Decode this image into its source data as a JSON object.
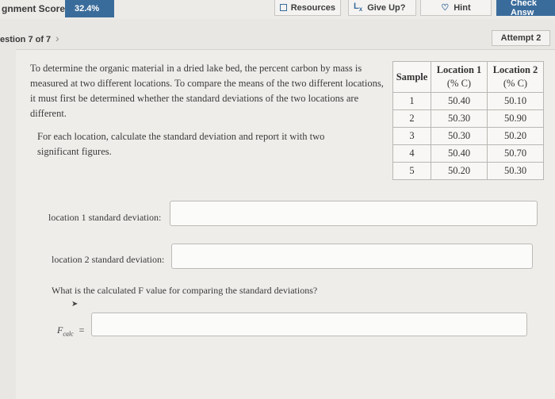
{
  "topbar": {
    "score_label": "gnment Score:",
    "score_value": "32.4%",
    "resources_label": "Resources",
    "giveup_label": "Give Up?",
    "hint_label": "Hint",
    "check_label": "Check Answ"
  },
  "nav": {
    "question_label": "estion 7 of 7",
    "next_glyph": "›",
    "attempt_label": "Attempt 2"
  },
  "question": {
    "paragraph1": "To determine the organic material in a dried lake bed, the percent carbon by mass is measured at two different locations. To compare the means of the two different locations, it must first be determined whether the standard deviations of the two locations are different.",
    "paragraph2": "For each location, calculate the standard deviation and report it with two significant figures."
  },
  "table": {
    "headers": [
      "Sample",
      "Location 1",
      "(% C)",
      "Location 2",
      "(% C)"
    ],
    "rows": [
      [
        "1",
        "50.40",
        "50.10"
      ],
      [
        "2",
        "50.30",
        "50.90"
      ],
      [
        "3",
        "50.30",
        "50.20"
      ],
      [
        "4",
        "50.40",
        "50.70"
      ],
      [
        "5",
        "50.20",
        "50.30"
      ]
    ]
  },
  "fields": {
    "loc1_label": "location 1 standard deviation:",
    "loc2_label": "location 2 standard deviation:",
    "f_question": "What is the calculated F value for comparing the standard deviations?",
    "fcalc_label": "F",
    "fcalc_sub": "calc",
    "fcalc_eq": "="
  },
  "colors": {
    "accent": "#3a6c9b",
    "background": "#e9e7e4"
  },
  "icons": [
    "resources-icon",
    "give-up-icon",
    "hint-icon",
    "chevron-right-icon",
    "cursor-icon"
  ]
}
